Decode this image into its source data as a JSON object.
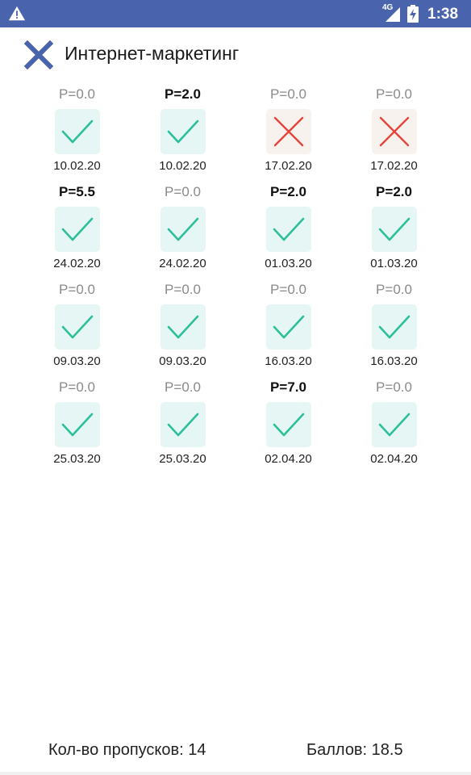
{
  "status_bar": {
    "network_label": "4G",
    "time": "1:38",
    "warning_icon": "warning-icon",
    "battery_icon": "battery-charging-icon"
  },
  "toolbar": {
    "close_icon": "close-icon",
    "title": "Интернет-маркетинг"
  },
  "colors": {
    "status_bar": "#4a63ad",
    "present_mark": "#2bbf9a",
    "present_bg": "#e6f6f4",
    "absent_mark": "#e5453b",
    "absent_bg": "#f8f2ef",
    "close_icon": "#4a63ad"
  },
  "sessions": [
    {
      "score": "P=0.0",
      "highlighted": false,
      "status": "present",
      "date": "10.02.20"
    },
    {
      "score": "P=2.0",
      "highlighted": true,
      "status": "present",
      "date": "10.02.20"
    },
    {
      "score": "P=0.0",
      "highlighted": false,
      "status": "absent",
      "date": "17.02.20"
    },
    {
      "score": "P=0.0",
      "highlighted": false,
      "status": "absent",
      "date": "17.02.20"
    },
    {
      "score": "P=5.5",
      "highlighted": true,
      "status": "present",
      "date": "24.02.20"
    },
    {
      "score": "P=0.0",
      "highlighted": false,
      "status": "present",
      "date": "24.02.20"
    },
    {
      "score": "P=2.0",
      "highlighted": true,
      "status": "present",
      "date": "01.03.20"
    },
    {
      "score": "P=2.0",
      "highlighted": true,
      "status": "present",
      "date": "01.03.20"
    },
    {
      "score": "P=0.0",
      "highlighted": false,
      "status": "present",
      "date": "09.03.20"
    },
    {
      "score": "P=0.0",
      "highlighted": false,
      "status": "present",
      "date": "09.03.20"
    },
    {
      "score": "P=0.0",
      "highlighted": false,
      "status": "present",
      "date": "16.03.20"
    },
    {
      "score": "P=0.0",
      "highlighted": false,
      "status": "present",
      "date": "16.03.20"
    },
    {
      "score": "P=0.0",
      "highlighted": false,
      "status": "present",
      "date": "25.03.20"
    },
    {
      "score": "P=0.0",
      "highlighted": false,
      "status": "present",
      "date": "25.03.20"
    },
    {
      "score": "P=7.0",
      "highlighted": true,
      "status": "present",
      "date": "02.04.20"
    },
    {
      "score": "P=0.0",
      "highlighted": false,
      "status": "present",
      "date": "02.04.20"
    }
  ],
  "footer": {
    "misses": "Кол-во пропусков: 14",
    "points": "Баллов: 18.5"
  }
}
